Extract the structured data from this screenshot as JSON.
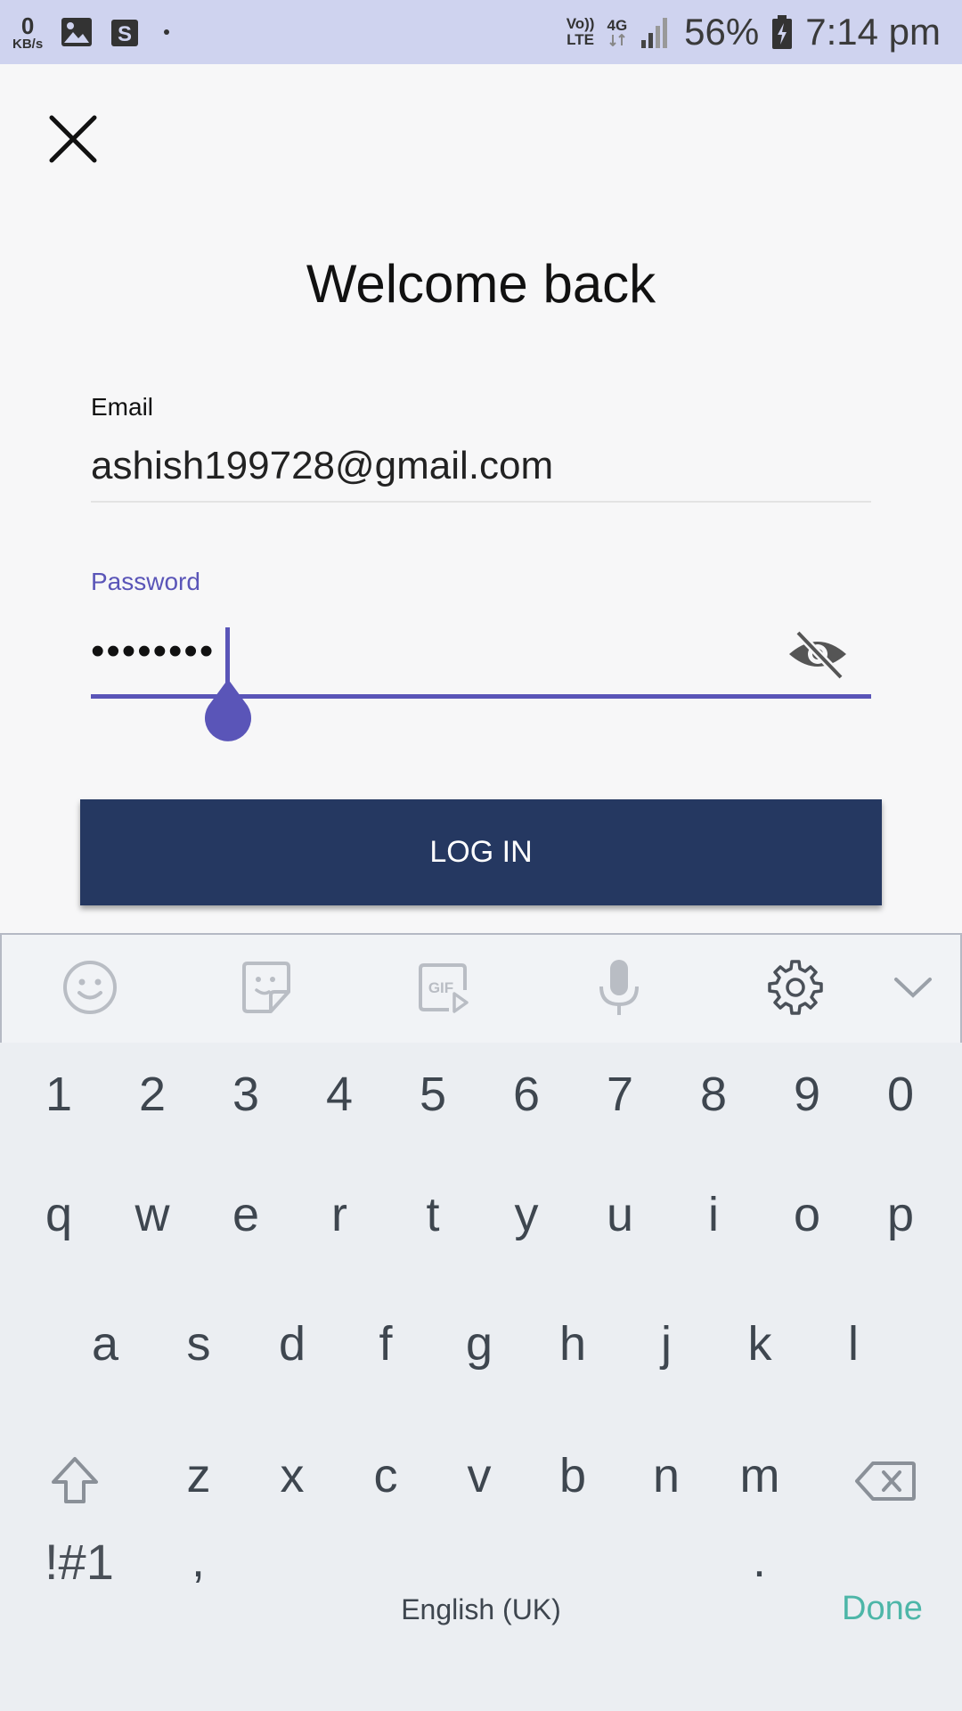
{
  "status_bar": {
    "net_speed_value": "0",
    "net_speed_unit": "KB/s",
    "volte_line1": "Vo))",
    "volte_line2": "LTE",
    "network_type": "4G",
    "battery_percent": "56%",
    "time": "7:14 pm"
  },
  "login": {
    "title": "Welcome back",
    "email_label": "Email",
    "email_value": "ashish199728@gmail.com",
    "password_label": "Password",
    "password_value": "••••••••",
    "login_button": "LOG IN",
    "accent_color": "#5a55b8",
    "button_color": "#253861"
  },
  "keyboard": {
    "toolbar_icons": [
      "emoji-icon",
      "sticker-icon",
      "gif-icon",
      "microphone-icon",
      "settings-icon",
      "collapse-icon"
    ],
    "number_row": [
      "1",
      "2",
      "3",
      "4",
      "5",
      "6",
      "7",
      "8",
      "9",
      "0"
    ],
    "row1": [
      "q",
      "w",
      "e",
      "r",
      "t",
      "y",
      "u",
      "i",
      "o",
      "p"
    ],
    "row2": [
      "a",
      "s",
      "d",
      "f",
      "g",
      "h",
      "j",
      "k",
      "l"
    ],
    "row3": [
      "z",
      "x",
      "c",
      "v",
      "b",
      "n",
      "m"
    ],
    "symbols_key": "!#1",
    "comma_key": ",",
    "space_label": "English (UK)",
    "period_key": ".",
    "done_key": "Done"
  }
}
